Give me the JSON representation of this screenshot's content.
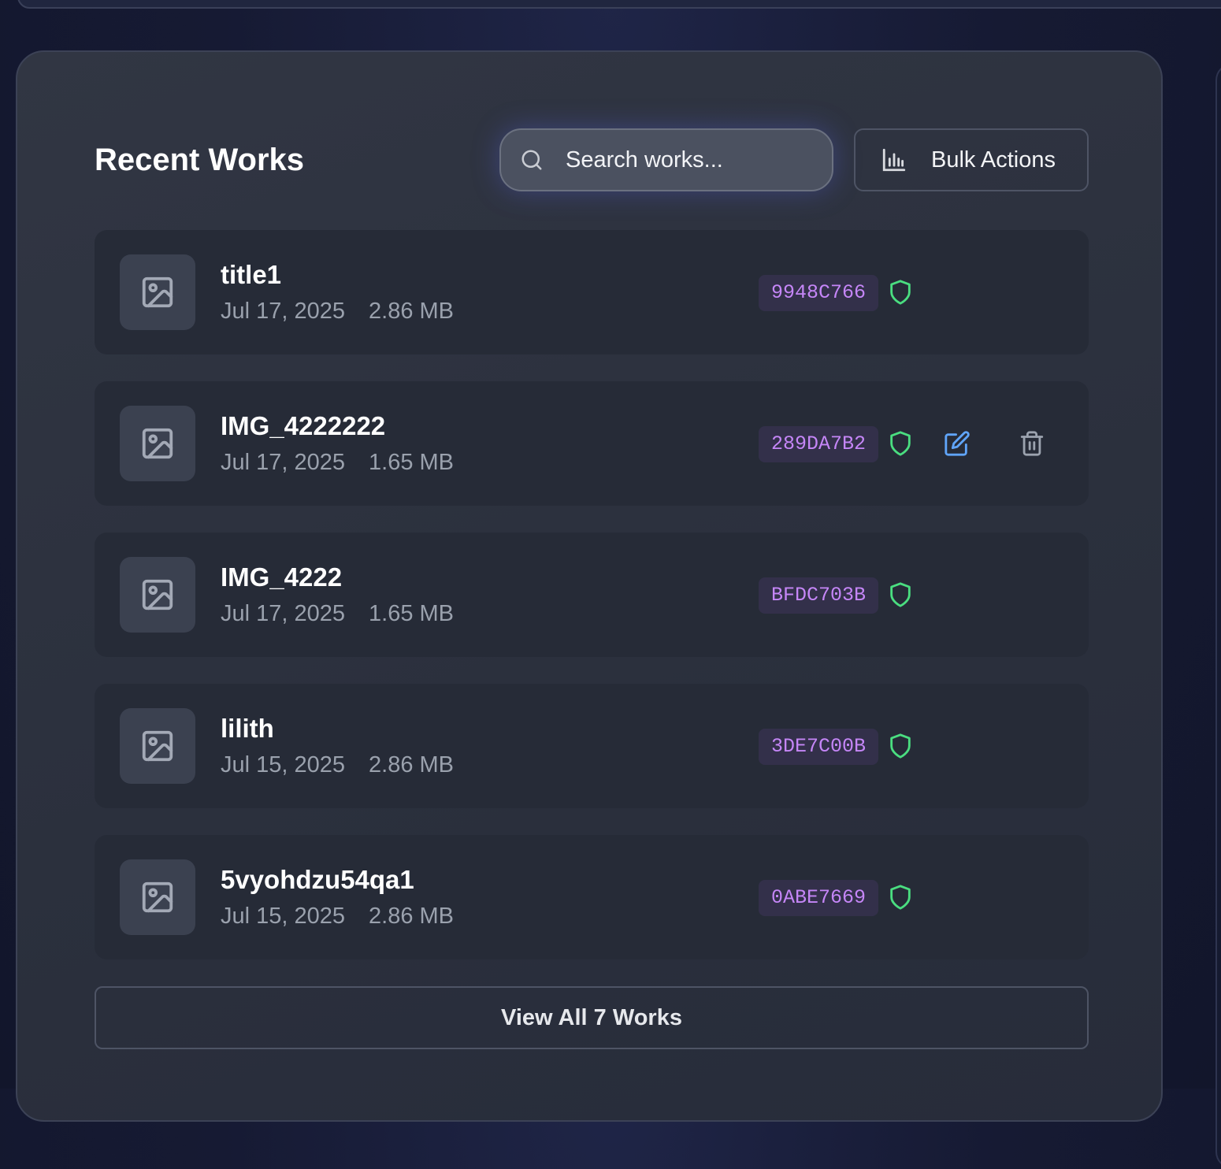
{
  "header": {
    "title": "Recent Works"
  },
  "search": {
    "placeholder": "Search works..."
  },
  "toolbar": {
    "bulk_actions_label": "Bulk Actions"
  },
  "works": [
    {
      "name": "title1",
      "date": "Jul 17, 2025",
      "size": "2.86 MB",
      "hash": "9948C766",
      "verified": true,
      "actions": []
    },
    {
      "name": "IMG_4222222",
      "date": "Jul 17, 2025",
      "size": "1.65 MB",
      "hash": "289DA7B2",
      "verified": true,
      "actions": [
        "edit",
        "delete"
      ]
    },
    {
      "name": "IMG_4222",
      "date": "Jul 17, 2025",
      "size": "1.65 MB",
      "hash": "BFDC703B",
      "verified": true,
      "actions": []
    },
    {
      "name": "lilith",
      "date": "Jul 15, 2025",
      "size": "2.86 MB",
      "hash": "3DE7C00B",
      "verified": true,
      "actions": []
    },
    {
      "name": "5vyohdzu54qa1",
      "date": "Jul 15, 2025",
      "size": "2.86 MB",
      "hash": "0ABE7669",
      "verified": true,
      "actions": []
    }
  ],
  "footer": {
    "view_all_label": "View All 7 Works"
  },
  "icons": {
    "search": "search-icon",
    "bulk": "bar-chart-icon",
    "thumbnail": "image-icon",
    "verified": "shield-icon",
    "edit": "edit-icon",
    "delete": "trash-icon"
  },
  "colors": {
    "hash_text": "#c586f7",
    "hash_bg": "#33304a",
    "shield": "#4ade80",
    "edit": "#60a5fa",
    "trash": "#9ca3af"
  }
}
